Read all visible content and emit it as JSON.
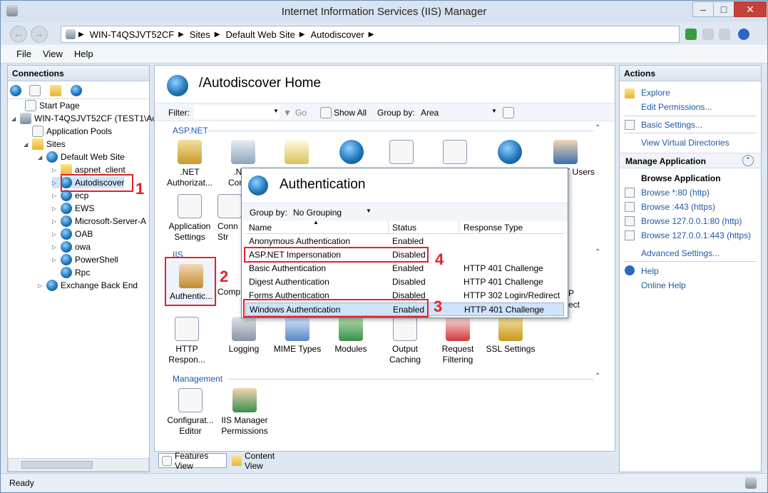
{
  "window": {
    "title": "Internet Information Services (IIS) Manager"
  },
  "address": {
    "crumbs": [
      "WIN-T4QSJVT52CF",
      "Sites",
      "Default Web Site",
      "Autodiscover"
    ]
  },
  "menu": [
    "File",
    "View",
    "Help"
  ],
  "connections": {
    "title": "Connections",
    "tree": [
      "Start Page",
      "WIN-T4QSJVT52CF (TEST1\\Ac",
      "Application Pools",
      "Sites",
      "Default Web Site",
      "aspnet_client",
      "Autodiscover",
      "ecp",
      "EWS",
      "Microsoft-Server-A",
      "OAB",
      "owa",
      "PowerShell",
      "Rpc",
      "Exchange Back End"
    ]
  },
  "home": {
    "title": "/Autodiscover Home",
    "filter_label": "Filter:",
    "go_label": "Go",
    "show_all_label": "Show All",
    "group_by_label": "Group by:",
    "group_by_value": "Area",
    "sections": {
      "aspnet": "ASP.NET",
      "iis": "IIS",
      "management": "Management"
    },
    "aspnet_features": [
      ".NET Authorizat...",
      ".NET Comp...",
      "",
      "",
      "",
      "",
      "",
      "",
      ".NET Users"
    ],
    "aspnet_row2": [
      "Application Settings",
      "Conn Str"
    ],
    "iis_features": [
      "Authentic...",
      "Comp"
    ],
    "iis_row2": [
      "HTTP Respon...",
      "Logging",
      "MIME Types",
      "Modules",
      "Output Caching",
      "Request Filtering",
      "SSL Settings"
    ],
    "mgmt_features": [
      "Configurat... Editor",
      "IIS Manager Permissions"
    ],
    "right_fragments": [
      "P",
      "ect"
    ]
  },
  "auth_dialog": {
    "title": "Authentication",
    "group_by_label": "Group by:",
    "group_by_value": "No Grouping",
    "columns": [
      "Name",
      "Status",
      "Response Type"
    ],
    "rows": [
      {
        "name": "Anonymous Authentication",
        "status": "Enabled",
        "response": ""
      },
      {
        "name": "ASP.NET Impersonation",
        "status": "Disabled",
        "response": ""
      },
      {
        "name": "Basic Authentication",
        "status": "Enabled",
        "response": "HTTP 401 Challenge"
      },
      {
        "name": "Digest Authentication",
        "status": "Disabled",
        "response": "HTTP 401 Challenge"
      },
      {
        "name": "Forms Authentication",
        "status": "Disabled",
        "response": "HTTP 302 Login/Redirect"
      },
      {
        "name": "Windows Authentication",
        "status": "Enabled",
        "response": "HTTP 401 Challenge"
      }
    ]
  },
  "annotations": [
    "1",
    "2",
    "3",
    "4"
  ],
  "views": {
    "features": "Features View",
    "content": "Content View"
  },
  "actions": {
    "title": "Actions",
    "explore": "Explore",
    "edit_permissions": "Edit Permissions...",
    "basic_settings": "Basic Settings...",
    "view_virtual_dirs": "View Virtual Directories",
    "manage_app": "Manage Application",
    "browse_app": "Browse Application",
    "browse_links": [
      "Browse *:80 (http)",
      "Browse :443 (https)",
      "Browse 127.0.0.1:80 (http)",
      "Browse 127.0.0.1:443 (https)"
    ],
    "advanced_settings": "Advanced Settings...",
    "help": "Help",
    "online_help": "Online Help"
  },
  "status": {
    "text": "Ready"
  },
  "colors": {
    "annotation_red": "#e2222a",
    "link_blue": "#1e5aa8",
    "selection": "#cfe3fb"
  }
}
